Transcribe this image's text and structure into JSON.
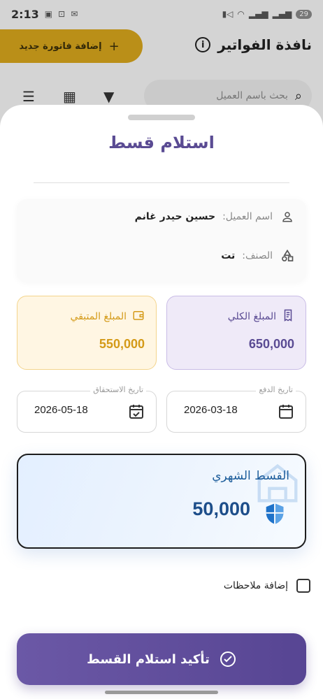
{
  "status_bar": {
    "time": "2:13",
    "battery": "29"
  },
  "app_header": {
    "title": "نافذة الفواتير",
    "add_invoice_label": "إضافة فاتورة جديد",
    "search_placeholder": "بحث باسم العميل"
  },
  "sheet": {
    "title": "استلام قسط",
    "customer": {
      "name_label": "اسم العميل:",
      "name_value": "حسين حيدر غانم",
      "category_label": "الصنف:",
      "category_value": "تت"
    },
    "total": {
      "label": "المبلغ الكلي",
      "value": "650,000"
    },
    "remaining": {
      "label": "المبلغ المتبقي",
      "value": "550,000"
    },
    "payment_date": {
      "label": "تاريخ الدفع",
      "value": "2026-03-18"
    },
    "due_date": {
      "label": "تاريخ الاستحقاق",
      "value": "2026-05-18"
    },
    "installment": {
      "label": "القسط الشهري",
      "value": "50,000"
    },
    "notes_label": "إضافة ملاحظات",
    "confirm_label": "تأكيد استلام القسط"
  },
  "colors": {
    "primary": "#5a4b93",
    "accent": "#d4a31c",
    "installment_text": "#1d4e8a",
    "shield": "#1f72c9"
  }
}
